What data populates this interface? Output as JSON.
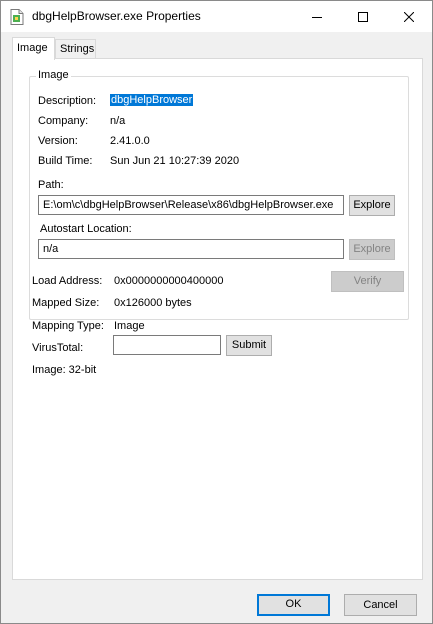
{
  "window": {
    "title": "dbgHelpBrowser.exe Properties"
  },
  "tabs": [
    {
      "label": "Image",
      "active": true
    },
    {
      "label": "Strings",
      "active": false
    }
  ],
  "image_group": {
    "legend": "Image",
    "description_label": "Description:",
    "description_value": "dbgHelpBrowser",
    "company_label": "Company:",
    "company_value": "n/a",
    "version_label": "Version:",
    "version_value": "2.41.0.0",
    "build_time_label": "Build Time:",
    "build_time_value": "Sun Jun 21 10:27:39 2020",
    "path_label": "Path:",
    "path_value": "E:\\om\\c\\dbgHelpBrowser\\Release\\x86\\dbgHelpBrowser.exe",
    "path_explore_label": "Explore",
    "autostart_label": "Autostart Location:",
    "autostart_value": "n/a",
    "autostart_explore_label": "Explore"
  },
  "details": {
    "load_address_label": "Load Address:",
    "load_address_value": "0x0000000000400000",
    "verify_label": "Verify",
    "mapped_size_label": "Mapped Size:",
    "mapped_size_value": "0x126000 bytes",
    "mapping_type_label": "Mapping Type:",
    "mapping_type_value": "Image",
    "virustotal_label": "VirusTotal:",
    "virustotal_value": "",
    "submit_label": "Submit",
    "image_bits": "Image: 32-bit"
  },
  "footer": {
    "ok_label": "OK",
    "cancel_label": "Cancel"
  },
  "colors": {
    "selection": "#0078d7",
    "dialog_bg": "#f0f0f0",
    "panel_bg": "#ffffff"
  }
}
